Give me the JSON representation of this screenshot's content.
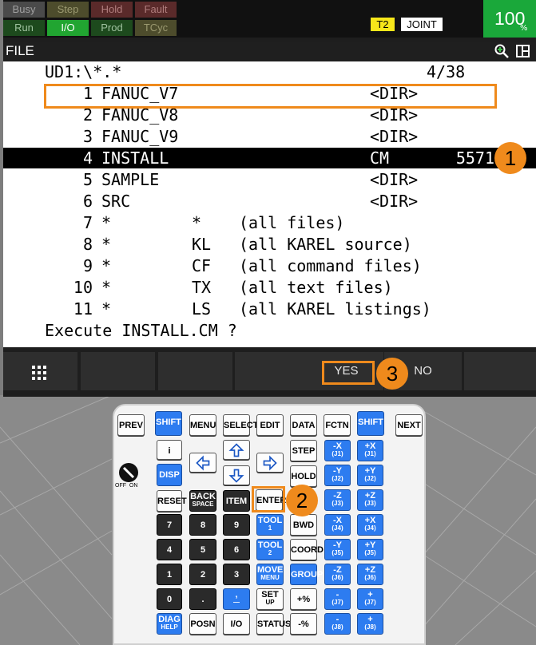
{
  "status": {
    "busy": "Busy",
    "step": "Step",
    "hold": "Hold",
    "fault": "Fault",
    "run": "Run",
    "io": "I/O",
    "prod": "Prod",
    "tcyc": "TCyc",
    "t2": "T2",
    "coord": "JOINT",
    "override_value": "100",
    "override_unit": "%"
  },
  "title": "FILE",
  "listing": {
    "path": "UD1:\\*.*",
    "position": "4/38",
    "rows": [
      {
        "num": "1",
        "name": "FANUC_V7",
        "ext": "",
        "desc": "<DIR>"
      },
      {
        "num": "2",
        "name": "FANUC_V8",
        "ext": "",
        "desc": "<DIR>"
      },
      {
        "num": "3",
        "name": "FANUC_V9",
        "ext": "",
        "desc": "<DIR>"
      },
      {
        "num": "4",
        "name": "INSTALL",
        "ext": "CM",
        "desc": "5571"
      },
      {
        "num": "5",
        "name": "SAMPLE",
        "ext": "",
        "desc": "<DIR>"
      },
      {
        "num": "6",
        "name": "SRC",
        "ext": "",
        "desc": "<DIR>"
      },
      {
        "num": "7",
        "name": "*",
        "ext": "*",
        "desc": "(all files)"
      },
      {
        "num": "8",
        "name": "*",
        "ext": "KL",
        "desc": "(all KAREL source)"
      },
      {
        "num": "9",
        "name": "*",
        "ext": "CF",
        "desc": "(all command files)"
      },
      {
        "num": "10",
        "name": "*",
        "ext": "TX",
        "desc": "(all text files)"
      },
      {
        "num": "11",
        "name": "*",
        "ext": "LS",
        "desc": "(all KAREL listings)"
      }
    ],
    "prompt": "Execute INSTALL.CM ?"
  },
  "function_keys": {
    "yes": "YES",
    "no": "NO"
  },
  "callouts": [
    "1",
    "2",
    "3"
  ],
  "keys": {
    "prev": "PREV",
    "shift": "SHIFT",
    "menu": "MENU",
    "select": "SELECT",
    "edit": "EDIT",
    "data": "DATA",
    "fctn": "FCTN",
    "next": "NEXT",
    "info": "i",
    "disp": "DISP",
    "step": "STEP",
    "hold": "HOLD",
    "reset": "RESET",
    "back": "BACK",
    "space": "SPACE",
    "item": "ITEM",
    "enter": "ENTER",
    "tool1": "TOOL",
    "tool1_n": "1",
    "tool2": "TOOL",
    "tool2_n": "2",
    "bwd": "BWD",
    "coord": "COORD",
    "move": "MOVE",
    "menu2": "MENU",
    "group": "GROUP",
    "set": "SET",
    "up": "UP",
    "diag": "DIAG",
    "help": "HELP",
    "posn": "POSN",
    "io": "I/O",
    "status": "STATUS",
    "n7": "7",
    "n8": "8",
    "n9": "9",
    "n4": "4",
    "n5": "5",
    "n6": "6",
    "n1": "1",
    "n2": "2",
    "n3": "3",
    "n0": "0",
    "dot": ".",
    "comma": ",",
    "dash": "—",
    "plus_pct": "+%",
    "minus_pct": "-%",
    "jog": [
      {
        "minus": "-X",
        "minus_sub": "(J1)",
        "plus": "+X",
        "plus_sub": "(J1)"
      },
      {
        "minus": "-Y",
        "minus_sub": "(J2)",
        "plus": "+Y",
        "plus_sub": "(J2)"
      },
      {
        "minus": "-Z",
        "minus_sub": "(J3)",
        "plus": "+Z",
        "plus_sub": "(J3)"
      },
      {
        "minus": "-X",
        "minus_sub": "(J4)",
        "plus": "+X",
        "plus_sub": "(J4)"
      },
      {
        "minus": "-Y",
        "minus_sub": "(J5)",
        "plus": "+Y",
        "plus_sub": "(J5)"
      },
      {
        "minus": "-Z",
        "minus_sub": "(J6)",
        "plus": "+Z",
        "plus_sub": "(J6)"
      },
      {
        "minus": "-",
        "minus_sub": "(J7)",
        "plus": "+",
        "plus_sub": "(J7)"
      },
      {
        "minus": "-",
        "minus_sub": "(J8)",
        "plus": "+",
        "plus_sub": "(J8)"
      }
    ],
    "off": "OFF",
    "on": "ON"
  },
  "colors": {
    "accent": "#ef8a1c",
    "io_green": "#21a531",
    "override_green": "#1aa83a",
    "key_blue": "#2d7cf0"
  }
}
